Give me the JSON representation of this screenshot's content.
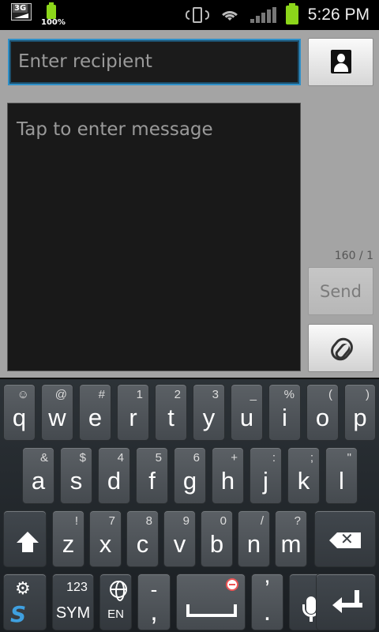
{
  "status_bar": {
    "network_label": "3G",
    "battery_percent_text": "100%",
    "time": "5:26 PM",
    "icons": [
      "network-3g-icon",
      "battery-icon",
      "vibrate-icon",
      "wifi-icon",
      "signal-icon",
      "battery-full-icon"
    ]
  },
  "compose": {
    "recipient_placeholder": "Enter recipient",
    "message_placeholder": "Tap to enter message",
    "char_counter": "160 / 1",
    "send_label": "Send",
    "contact_icon": "contact-icon",
    "attach_icon": "paperclip-icon"
  },
  "keyboard": {
    "row1": [
      {
        "main": "q",
        "sub": "☺"
      },
      {
        "main": "w",
        "sub": "@"
      },
      {
        "main": "e",
        "sub": "#"
      },
      {
        "main": "r",
        "sub": "1"
      },
      {
        "main": "t",
        "sub": "2"
      },
      {
        "main": "y",
        "sub": "3"
      },
      {
        "main": "u",
        "sub": "_"
      },
      {
        "main": "i",
        "sub": "%"
      },
      {
        "main": "o",
        "sub": "("
      },
      {
        "main": "p",
        "sub": ")"
      }
    ],
    "row2": [
      {
        "main": "a",
        "sub": "&"
      },
      {
        "main": "s",
        "sub": "$"
      },
      {
        "main": "d",
        "sub": "4"
      },
      {
        "main": "f",
        "sub": "5"
      },
      {
        "main": "g",
        "sub": "6"
      },
      {
        "main": "h",
        "sub": "+"
      },
      {
        "main": "j",
        "sub": ":"
      },
      {
        "main": "k",
        "sub": ";"
      },
      {
        "main": "l",
        "sub": "\""
      }
    ],
    "row3": [
      {
        "main": "z",
        "sub": "!"
      },
      {
        "main": "x",
        "sub": "7"
      },
      {
        "main": "c",
        "sub": "8"
      },
      {
        "main": "v",
        "sub": "9"
      },
      {
        "main": "b",
        "sub": "0"
      },
      {
        "main": "n",
        "sub": "/"
      },
      {
        "main": "m",
        "sub": "?"
      }
    ],
    "sym_top": "123",
    "sym_label": "SYM",
    "lang_label": "EN",
    "comma_main": ",",
    "comma_sub": "-",
    "period_main": ".",
    "period_sub": "’"
  }
}
